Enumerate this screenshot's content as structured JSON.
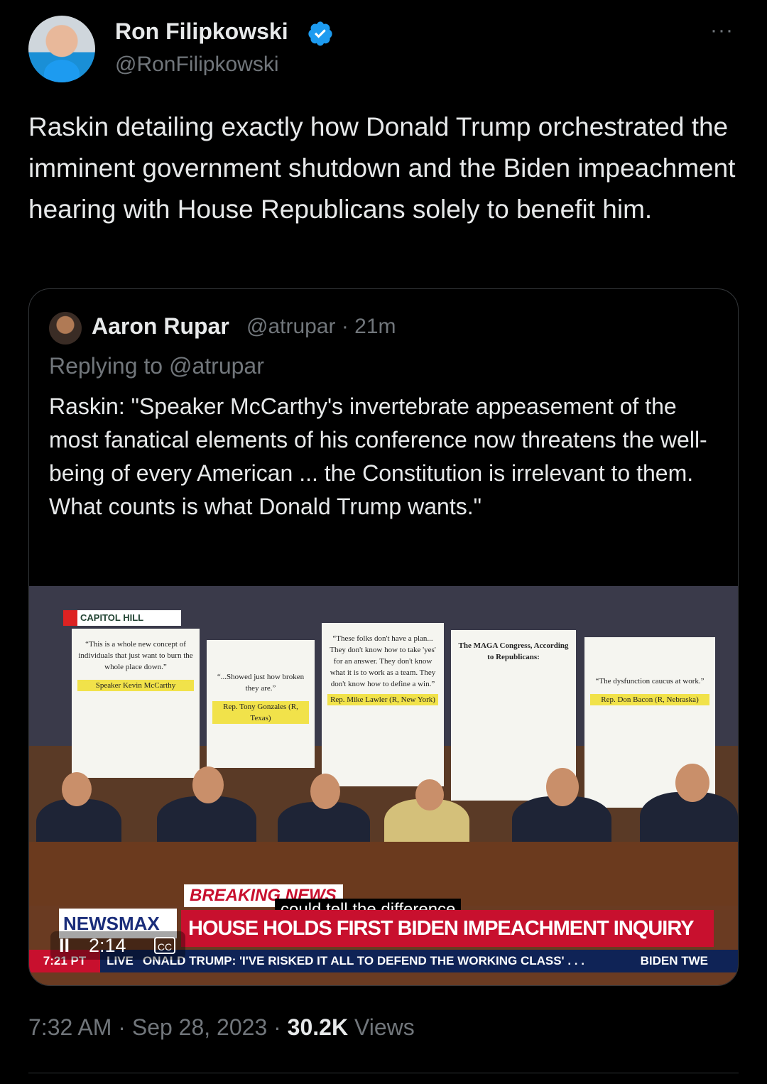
{
  "author": {
    "name": "Ron Filipkowski",
    "handle": "@RonFilipkowski",
    "verified_icon": "verified-badge-icon",
    "more_label": "···"
  },
  "tweet": {
    "text": "Raskin detailing exactly how Donald Trump orchestrated the imminent government shutdown and the Biden impeachment hearing with House Republicans solely to benefit him."
  },
  "quote": {
    "name": "Aaron Rupar",
    "meta": "@atrupar · 21m",
    "replying": "Replying to @atrupar",
    "text": "Raskin: \"Speaker McCarthy's invertebrate appeasement of the most fanatical elements of his conference now threatens the well-being of every American ... the Constitution is irrelevant to them. What counts is what Donald Trump wants.\""
  },
  "video": {
    "location_tag": "CAPITOL HILL",
    "posters": [
      "“This is a whole new concept of individuals that just want to burn the whole place down.”",
      "Speaker Kevin McCarthy",
      "“...Showed just how broken they are.”",
      "Rep. Tony Gonzales (R, Texas)",
      "“These folks don't have a plan... They don't know how to take 'yes' for an answer. They don't know what it is to work as a team. They don't know how to define a win.”",
      "Rep. Mike Lawler (R, New York)",
      "The MAGA Congress, According to Republicans:",
      "“The dysfunction caucus at work.”",
      "Rep. Don Bacon (R, Nebraska)"
    ],
    "breaking": "BREAKING NEWS",
    "caption": "could tell the difference",
    "network": "NEWSMAX",
    "headline": "HOUSE HOLDS FIRST BIDEN IMPEACHMENT INQUIRY HEARING",
    "ticker_time": "7:21 PT",
    "ticker_live": "LIVE",
    "ticker_text": "ONALD TRUMP: 'I'VE RISKED IT ALL TO DEFEND THE WORKING CLASS' . . .",
    "ticker_right": "BIDEN TWE",
    "duration": "2:14",
    "cc_label": "CC"
  },
  "footer": {
    "time": "7:32 AM · Sep 28, 2023 · ",
    "views_count": "30.2K",
    "views_label": " Views"
  }
}
